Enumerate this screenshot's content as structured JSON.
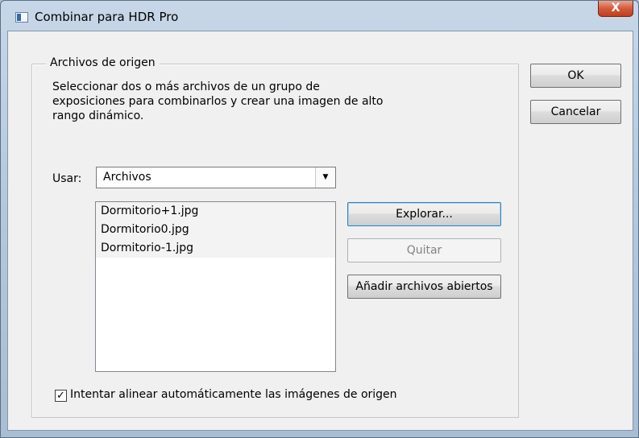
{
  "window": {
    "title": "Combinar para HDR Pro",
    "close_label": "X"
  },
  "group": {
    "legend": "Archivos de origen",
    "description_lines": [
      "Seleccionar dos o más archivos de un grupo de",
      "exposiciones para combinarlos y crear una imagen de alto",
      "rango dinámico."
    ]
  },
  "usar": {
    "label": "Usar:",
    "selected": "Archivos"
  },
  "files": [
    "Dormitorio+1.jpg",
    "Dormitorio0.jpg",
    "Dormitorio-1.jpg"
  ],
  "buttons": {
    "ok": "OK",
    "cancel": "Cancelar",
    "browse": "Explorar...",
    "remove": "Quitar",
    "add_open": "Añadir archivos abiertos"
  },
  "align": {
    "checked": true,
    "label": "Intentar alinear automáticamente las imágenes de origen"
  }
}
